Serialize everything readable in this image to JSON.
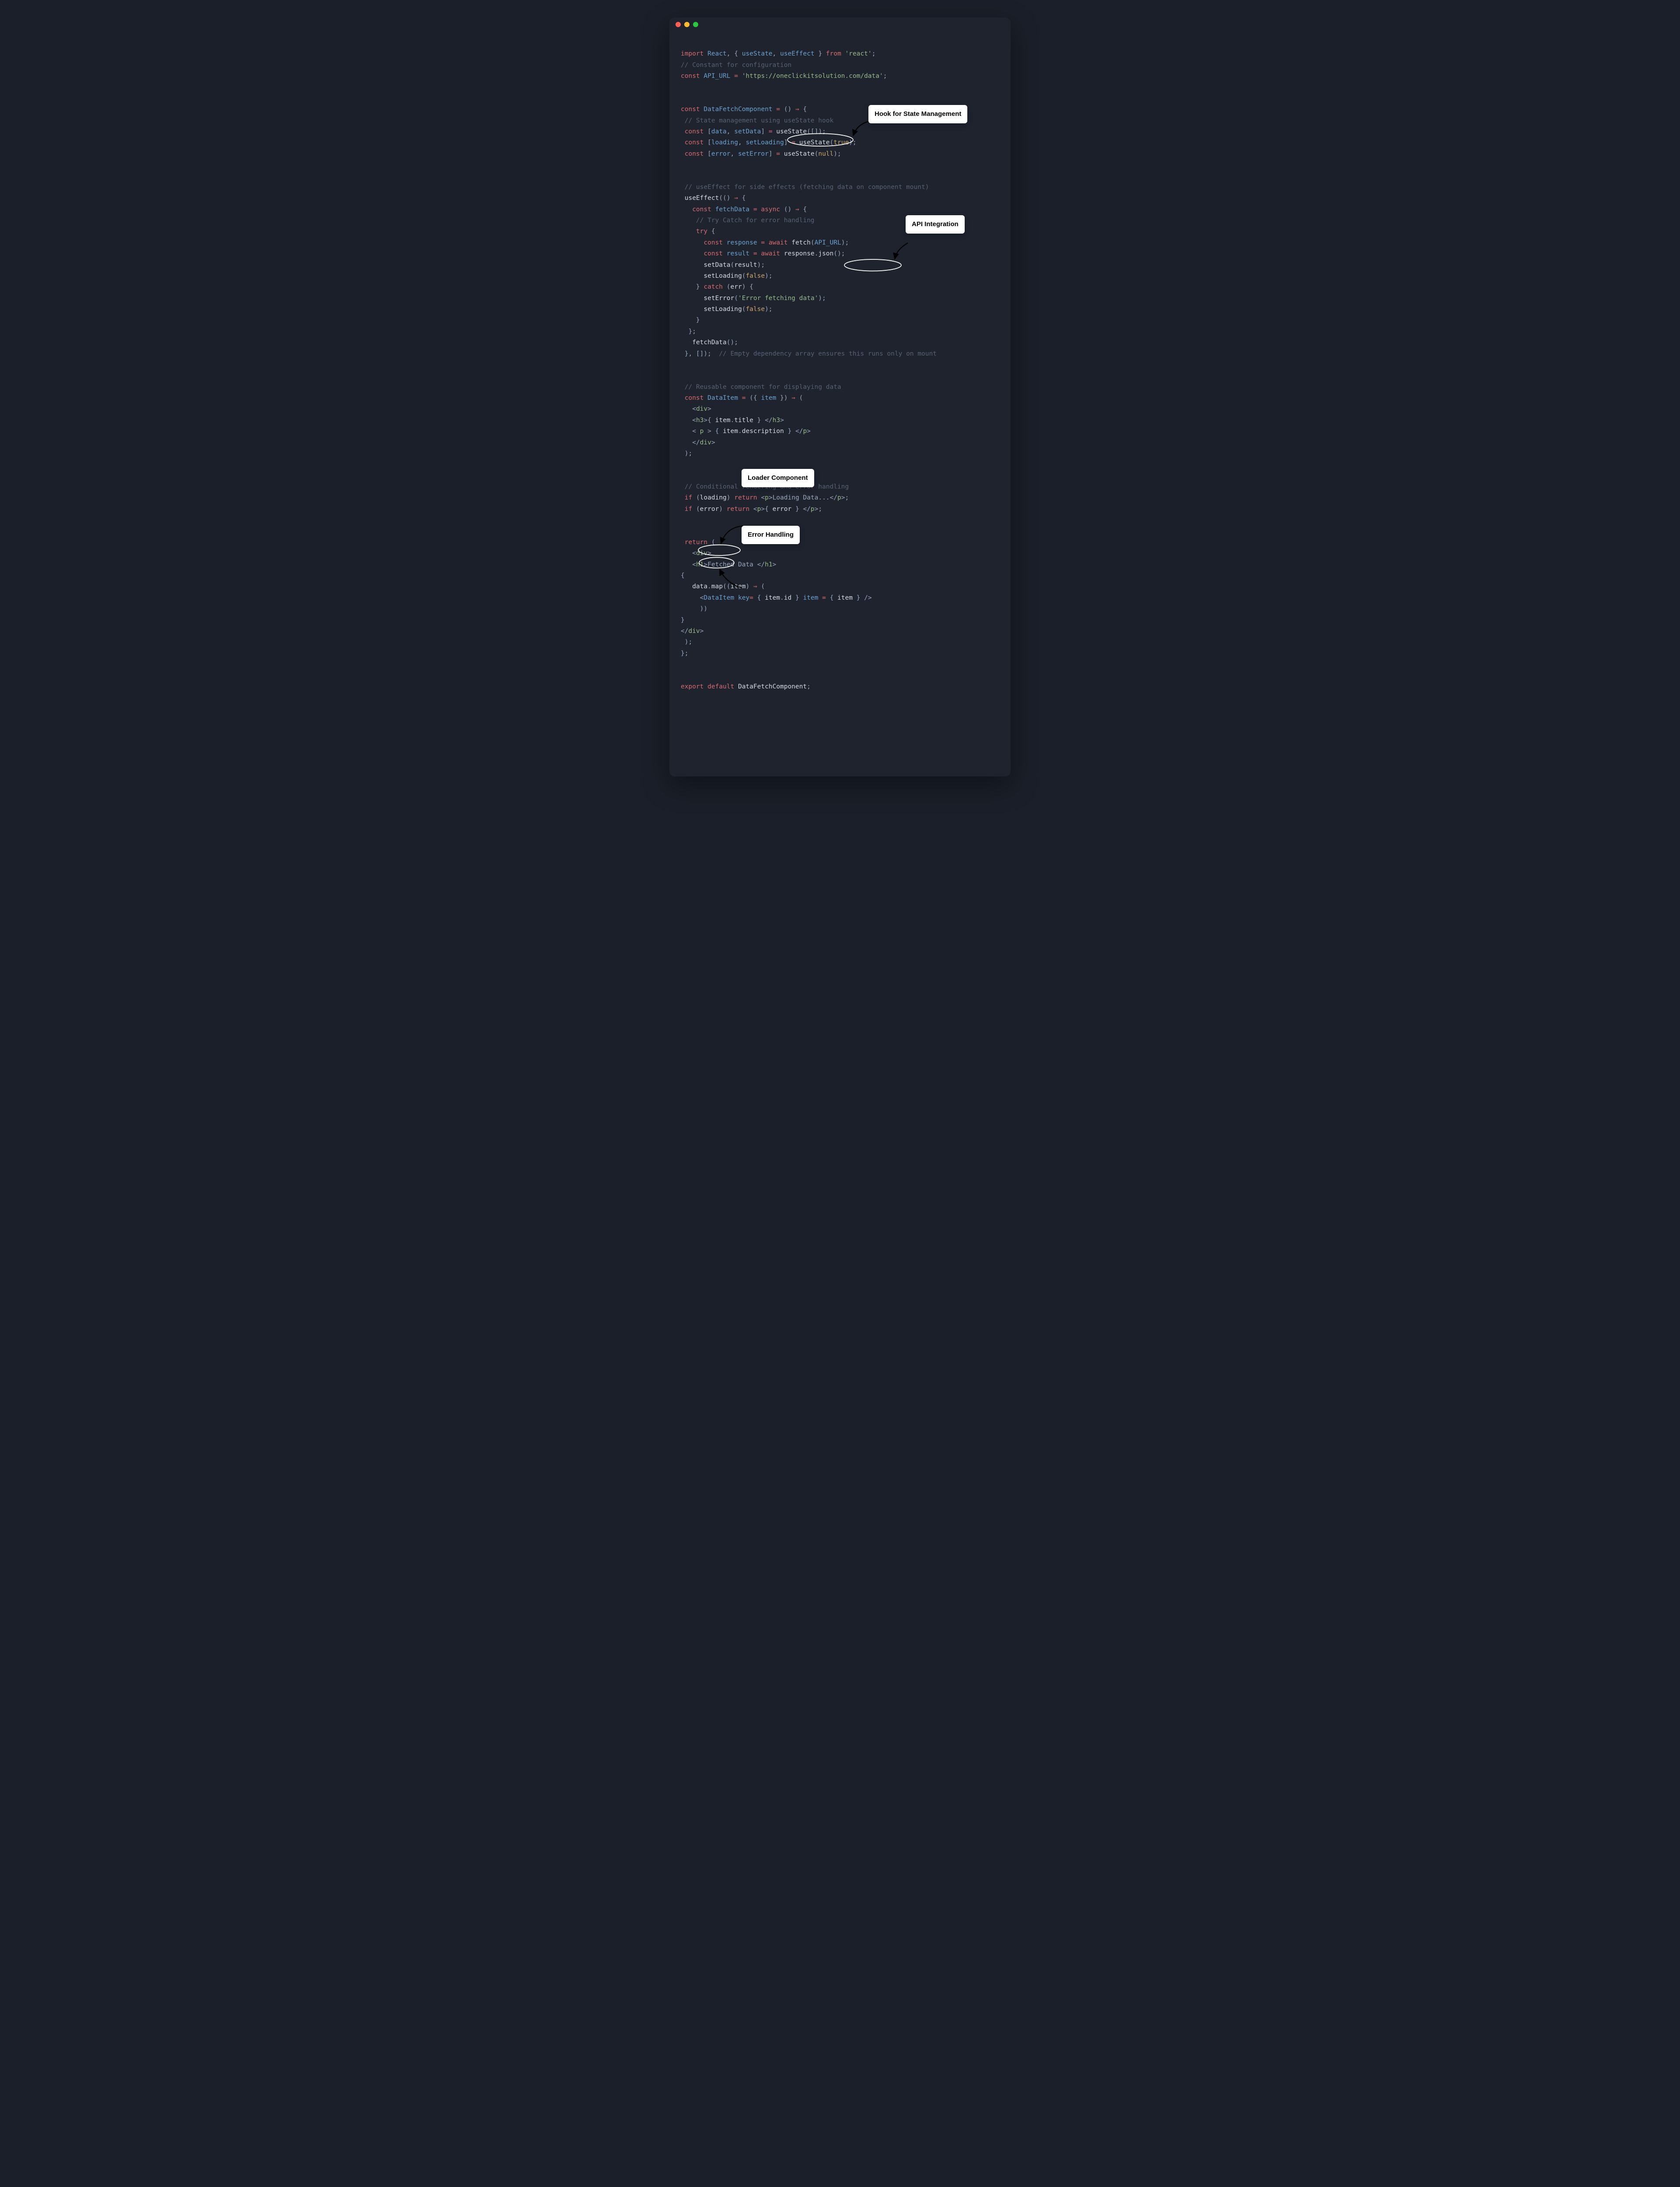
{
  "annotations": {
    "state_hook": "Hook for State Management",
    "api_integration": "API Integration",
    "loader_component": "Loader Component",
    "error_handling": "Error Handling"
  },
  "code_tokens": {
    "import": "import",
    "react": "React",
    "useState": "useState",
    "useEffect": "useEffect",
    "from": "from",
    "react_pkg": "'react'",
    "const": "const",
    "api_url_name": "API_URL",
    "api_url_val": "'https://oneclickitsolution.com/data'",
    "component_name": "DataFetchComponent",
    "data": "data",
    "setData": "setData",
    "loading": "loading",
    "setLoading": "setLoading",
    "error": "error",
    "setError": "setError",
    "true": "true",
    "false": "false",
    "null": "null",
    "fetchData": "fetchData",
    "async": "async",
    "try": "try",
    "catch": "catch",
    "err": "err",
    "response": "response",
    "await": "await",
    "fetch": "fetch",
    "result": "result",
    "json": "json",
    "error_msg": "'Error fetching data'",
    "DataItem": "DataItem",
    "item": "item",
    "title": "title",
    "description": "description",
    "div": "div",
    "h3": "h3",
    "p": "p",
    "h1": "h1",
    "if": "if",
    "return": "return",
    "loading_text": "Loading Data...",
    "fetched_heading": "Fetched Data ",
    "map": "map",
    "key": "key",
    "id": "id",
    "export": "export",
    "default": "default",
    "cm_config": "// Constant for configuration",
    "cm_state": " // State management using useState hook",
    "cm_effect": " // useEffect for side effects (fetching data on component mount)",
    "cm_trycatch": "    // Try Catch for error handling",
    "cm_dep": "// Empty dependency array ensures this runs only on mount",
    "cm_reusable": " // Reusable component for displaying data",
    "cm_cond": " // Conditional rendering and error handling"
  }
}
